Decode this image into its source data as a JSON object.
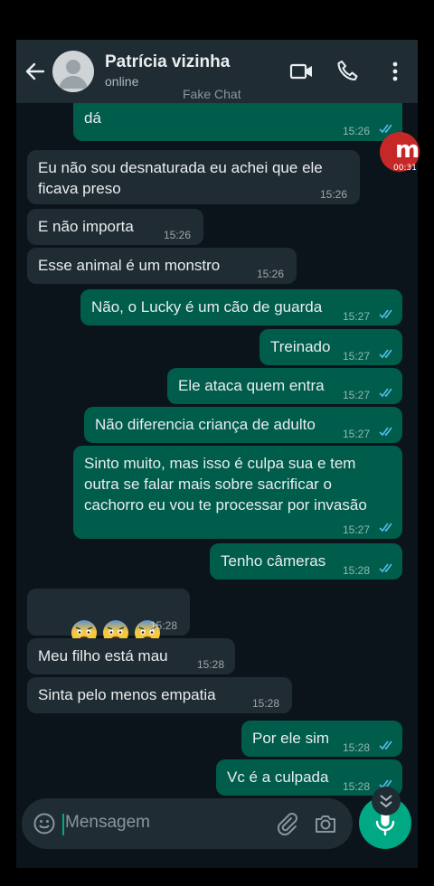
{
  "contact": {
    "name": "Patrícia vizinha",
    "status": "online"
  },
  "overlay_label": "Fake Chat",
  "badge": {
    "letter": "m",
    "time": "00:31"
  },
  "messages": [
    {
      "dir": "out",
      "text": "colocar a vida do seu filho em risco não\ndá",
      "time": "15:26"
    },
    {
      "dir": "in",
      "text": "Eu não sou desnaturada eu achei que ele\nficava preso",
      "time": "15:26"
    },
    {
      "dir": "in",
      "text": "E não importa",
      "time": "15:26"
    },
    {
      "dir": "in",
      "text": "Esse animal é um monstro",
      "time": "15:26"
    },
    {
      "dir": "out",
      "text": "Não, o Lucky é um cão de guarda",
      "time": "15:27"
    },
    {
      "dir": "out",
      "text": "Treinado",
      "time": "15:27"
    },
    {
      "dir": "out",
      "text": "Ele ataca quem entra",
      "time": "15:27"
    },
    {
      "dir": "out",
      "text": "Não diferencia criança de adulto",
      "time": "15:27"
    },
    {
      "dir": "out",
      "text": "Sinto muito, mas isso é culpa sua e tem\noutra se falar mais sobre sacrificar o\ncachorro eu vou te processar por invasão",
      "time": "15:27"
    },
    {
      "dir": "out",
      "text": "Tenho câmeras",
      "time": "15:28"
    },
    {
      "dir": "in",
      "emoji": [
        "anxious-face",
        "anxious-face",
        "anxious-face"
      ],
      "time": "15:28"
    },
    {
      "dir": "in",
      "text": "Meu filho está mau",
      "time": "15:28"
    },
    {
      "dir": "in",
      "text": "Sinta pelo menos empatia",
      "time": "15:28"
    },
    {
      "dir": "out",
      "text": "Por ele sim",
      "time": "15:28"
    },
    {
      "dir": "out",
      "text": "Vc é a culpada",
      "time": "15:28"
    }
  ],
  "composer": {
    "placeholder": "Mensagem"
  },
  "colors": {
    "background": "#0b141a",
    "header": "#1f2c34",
    "outgoing_bubble": "#005c4b",
    "incoming_bubble": "#202c33",
    "accent": "#00a884",
    "read_ticks": "#53bdeb"
  }
}
